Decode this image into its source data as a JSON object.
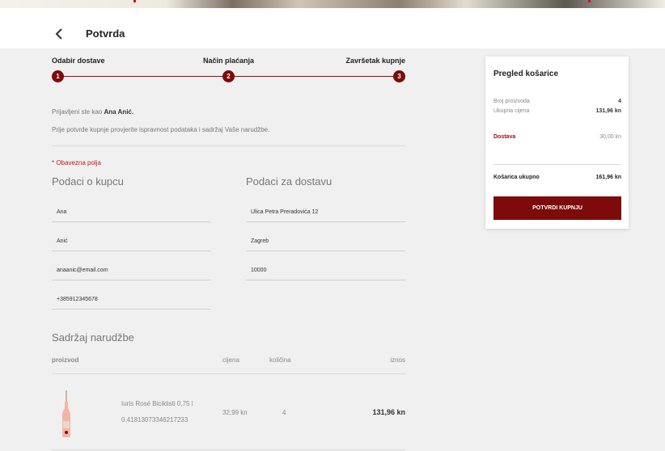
{
  "header": {
    "title": "Potvrda"
  },
  "steps": [
    {
      "label": "Odabir dostave",
      "number": "1"
    },
    {
      "label": "Način plaćanja",
      "number": "2"
    },
    {
      "label": "Završetak kupnje",
      "number": "3"
    }
  ],
  "intro": {
    "logged_prefix": "Prijavljeni ste kao ",
    "user_name": "Ana Anić.",
    "check_text": "Prije potvrde kupnje provjerite ispravnost podataka i sadržaj Vaše narudžbe."
  },
  "required_note": "* Obavezna polja",
  "buyer": {
    "heading": "Podaci o kupcu",
    "first_name": "Ana",
    "last_name": "Anić",
    "email": "anaanic@email.com",
    "phone": "+385912345678"
  },
  "delivery": {
    "heading": "Podaci za dostavu",
    "street": "Ulica Petra Preradovića 12",
    "city": "Zagreb",
    "postcode": "10000"
  },
  "order": {
    "heading": "Sadržaj narudžbe",
    "columns": {
      "product": "proizvod",
      "price": "cijena",
      "qty": "količina",
      "total": "iznos"
    },
    "items": [
      {
        "name": "Iuris Rosé Biciklisti 0,75 l",
        "sku": "0.41813073346217233",
        "price": "32,99 kn",
        "qty": "4",
        "total": "131,96 kn"
      }
    ]
  },
  "summary": {
    "title": "Pregled košarice",
    "count_label": "Broj proizvoda",
    "count_value": "4",
    "subtotal_label": "Ukupna cijena",
    "subtotal_value": "131,96 kn",
    "shipping_label": "Dostava",
    "shipping_value": "30,00 kn",
    "total_label": "Košarica ukupno",
    "total_value": "161,96 kn",
    "confirm_label": "POTVRDI KUPNJU"
  },
  "colors": {
    "accent": "#7d0b0b",
    "required": "#c4161c"
  }
}
